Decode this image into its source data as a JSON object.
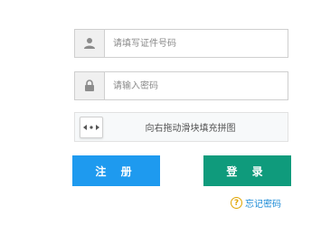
{
  "form": {
    "id_field": {
      "placeholder": "请填写证件号码",
      "value": "",
      "icon": "user-icon"
    },
    "password_field": {
      "placeholder": "请输入密码",
      "value": "",
      "icon": "lock-icon"
    },
    "slider_captcha": {
      "text": "向右拖动滑块填充拼图",
      "handle_icon": "slider-arrows-icon"
    }
  },
  "buttons": {
    "register_label": "注 册",
    "login_label": "登 录"
  },
  "forgot": {
    "icon_glyph": "?",
    "label": "忘记密码"
  },
  "colors": {
    "register": "#1e9aef",
    "login": "#0f9b7c",
    "link": "#1a8ad6",
    "help_icon": "#e0a400"
  }
}
